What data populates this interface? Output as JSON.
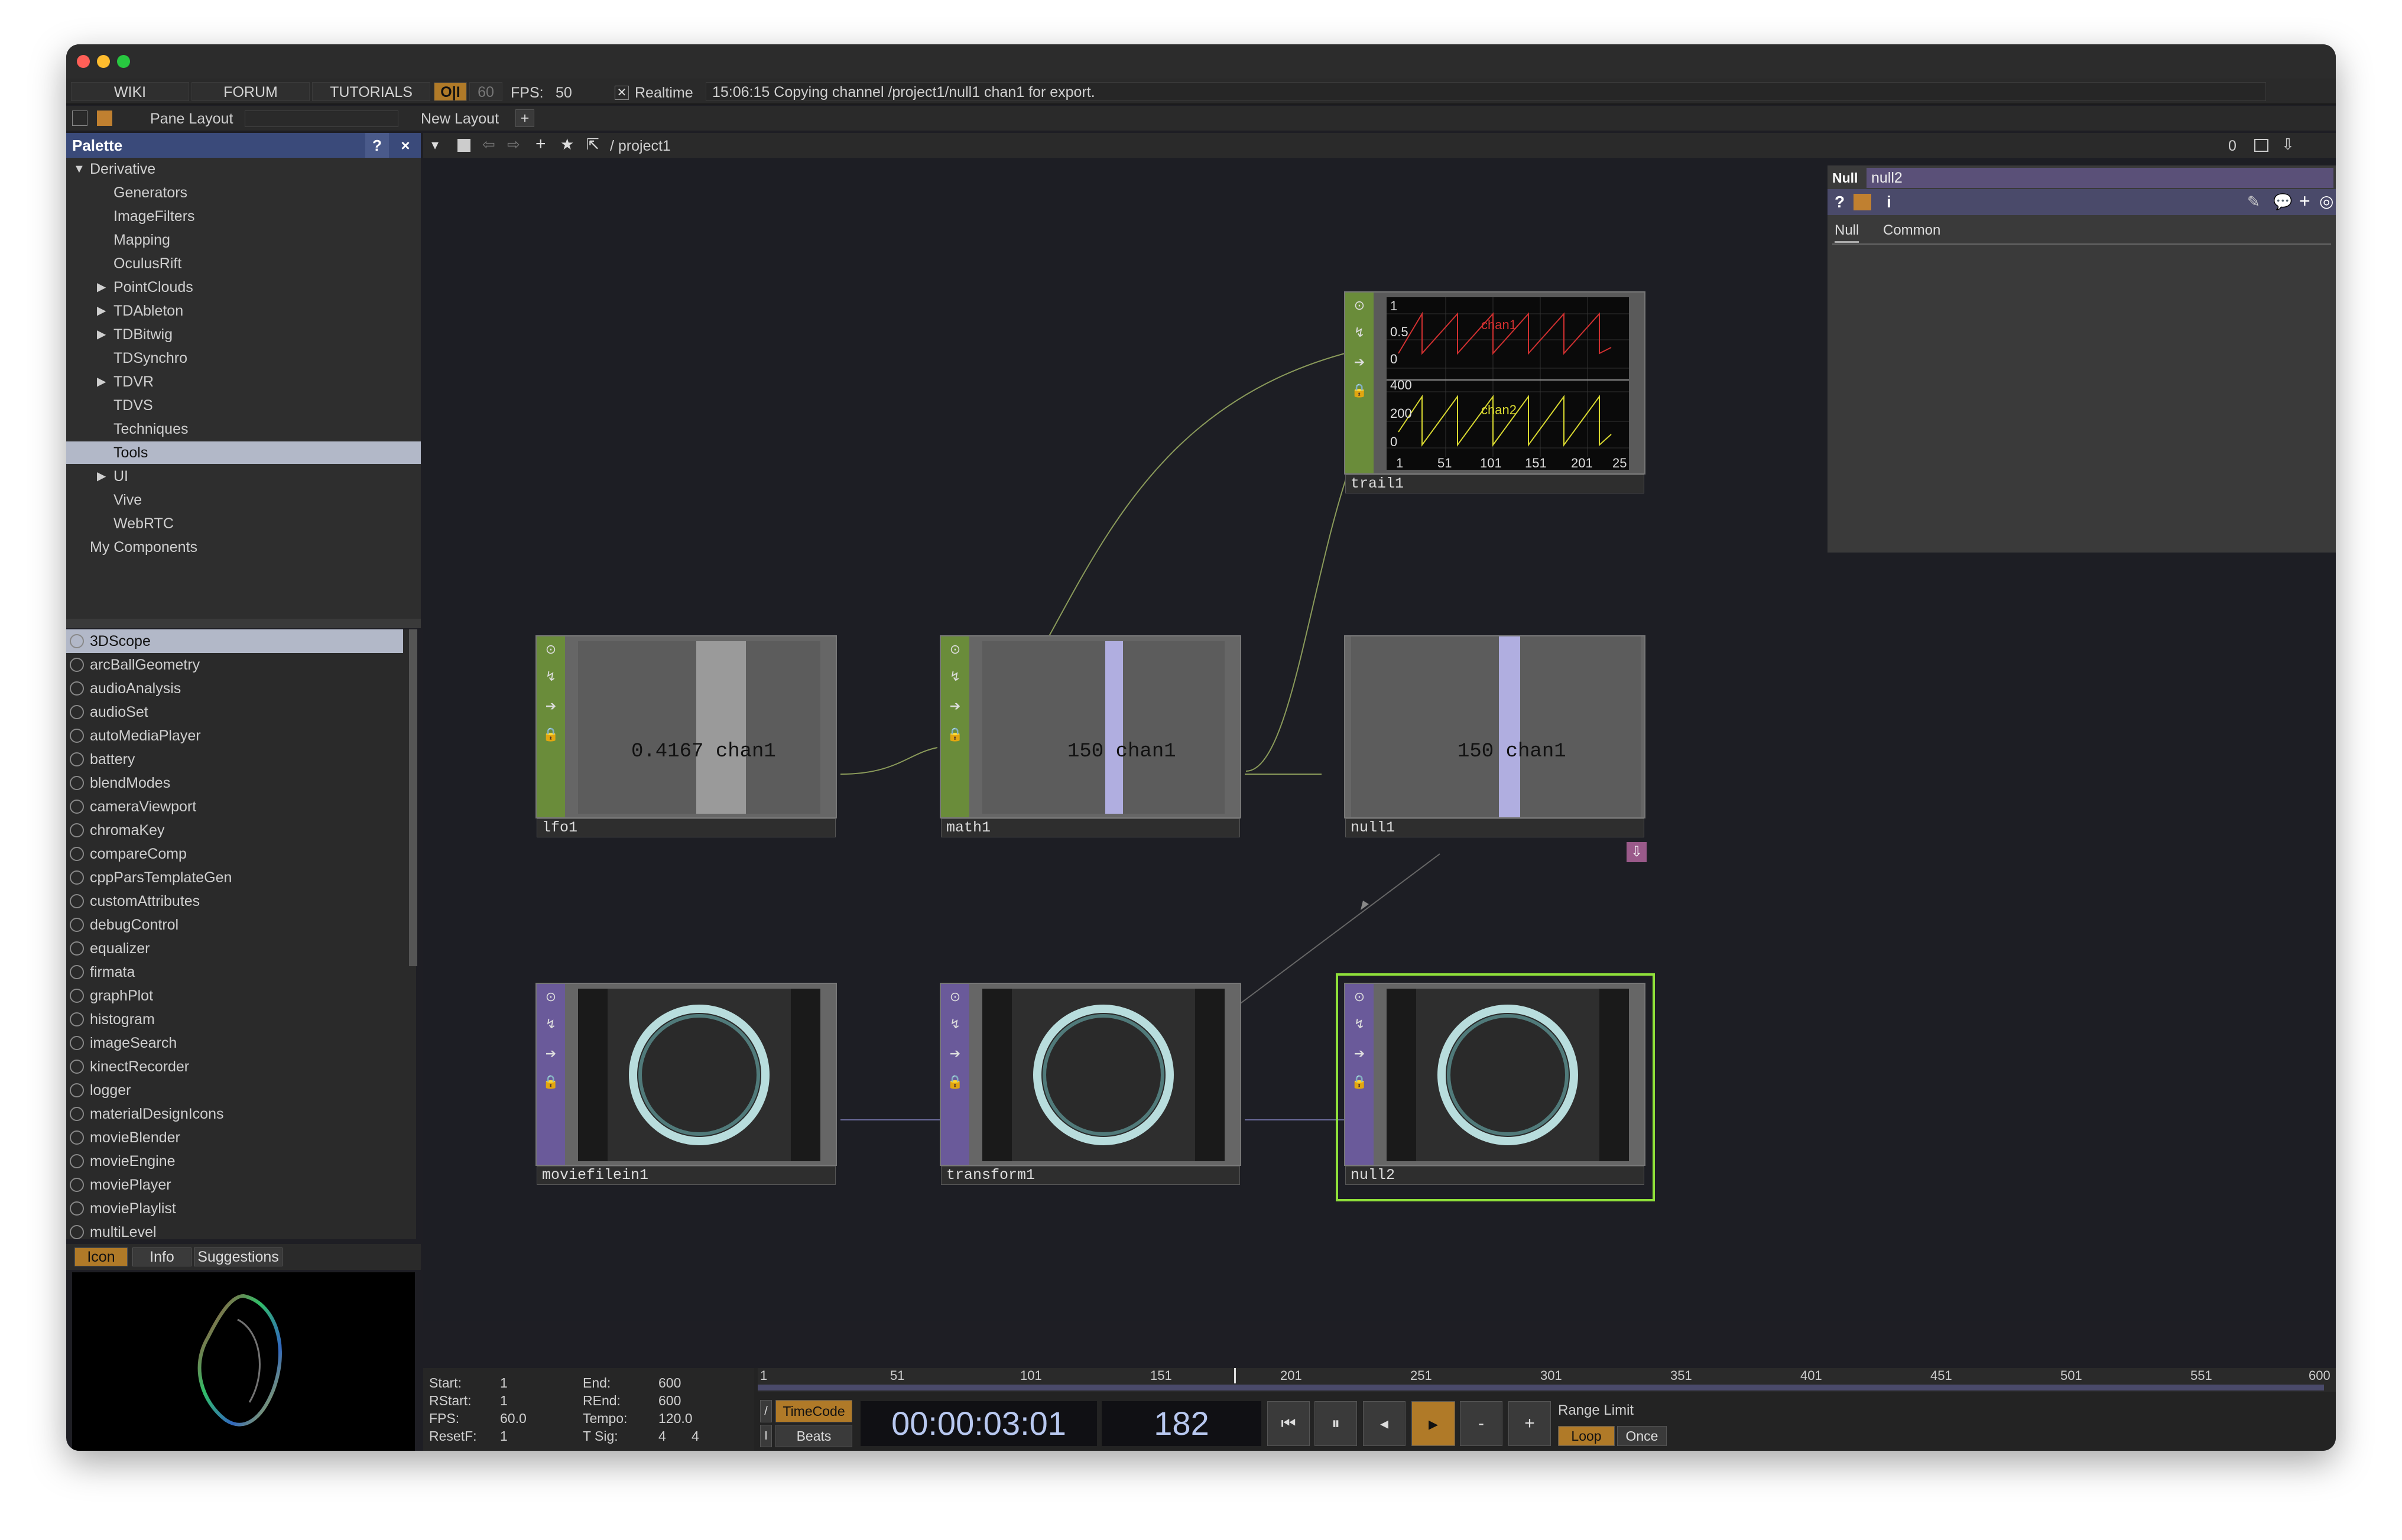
{
  "menubar": {
    "wiki": "WIKI",
    "forum": "FORUM",
    "tutorials": "TUTORIALS",
    "perf": "O|I",
    "fps_cap": "60",
    "fps_label": "FPS:",
    "fps_value": "50",
    "realtime": "Realtime",
    "status": "15:06:15 Copying channel /project1/null1 chan1 for export."
  },
  "toolbar2": {
    "pane_layout": "Pane Layout",
    "new_layout": "New Layout",
    "plus": "+"
  },
  "palette": {
    "title": "Palette",
    "help": "?",
    "close": "×",
    "tree": [
      {
        "label": "Derivative",
        "level": 0,
        "arrow": "down"
      },
      {
        "label": "Generators",
        "level": 1
      },
      {
        "label": "ImageFilters",
        "level": 1
      },
      {
        "label": "Mapping",
        "level": 1
      },
      {
        "label": "OculusRift",
        "level": 1
      },
      {
        "label": "PointClouds",
        "level": 1,
        "arrow": "right"
      },
      {
        "label": "TDAbleton",
        "level": 1,
        "arrow": "right"
      },
      {
        "label": "TDBitwig",
        "level": 1,
        "arrow": "right"
      },
      {
        "label": "TDSynchro",
        "level": 1
      },
      {
        "label": "TDVR",
        "level": 1,
        "arrow": "right"
      },
      {
        "label": "TDVS",
        "level": 1
      },
      {
        "label": "Techniques",
        "level": 1
      },
      {
        "label": "Tools",
        "level": 1,
        "selected": true
      },
      {
        "label": "UI",
        "level": 1,
        "arrow": "right"
      },
      {
        "label": "Vive",
        "level": 1
      },
      {
        "label": "WebRTC",
        "level": 1
      },
      {
        "label": "My Components",
        "level": 0
      }
    ],
    "components": [
      "3DScope",
      "arcBallGeometry",
      "audioAnalysis",
      "audioSet",
      "autoMediaPlayer",
      "battery",
      "blendModes",
      "cameraViewport",
      "chromaKey",
      "compareComp",
      "cppParsTemplateGen",
      "customAttributes",
      "debugControl",
      "equalizer",
      "firmata",
      "graphPlot",
      "histogram",
      "imageSearch",
      "kinectRecorder",
      "logger",
      "materialDesignIcons",
      "movieBlender",
      "movieEngine",
      "moviePlayer",
      "moviePlaylist",
      "multiLevel"
    ],
    "preview_tabs": [
      "Icon",
      "Info",
      "Suggestions"
    ]
  },
  "network": {
    "path": "/ project1",
    "counter": "0"
  },
  "nodes": {
    "lfo1": {
      "name": "lfo1",
      "value": "0.4167 chan1"
    },
    "math1": {
      "name": "math1",
      "value": "150 chan1"
    },
    "null1": {
      "name": "null1",
      "value": "150 chan1"
    },
    "trail1": {
      "name": "trail1",
      "chan1": "chan1",
      "chan2": "chan2",
      "y1": [
        "1",
        "0.5",
        "0"
      ],
      "y2": [
        "400",
        "200",
        "0"
      ],
      "x": [
        "1",
        "51",
        "101",
        "151",
        "201",
        "25"
      ]
    },
    "moviefilein1": {
      "name": "moviefilein1"
    },
    "transform1": {
      "name": "transform1"
    },
    "null2": {
      "name": "null2"
    }
  },
  "params": {
    "type": "Null",
    "name": "null2",
    "tabs": [
      "Null",
      "Common"
    ],
    "help": "?",
    "info": "i"
  },
  "timeline": {
    "ticks": [
      "1",
      "51",
      "101",
      "151",
      "201",
      "251",
      "301",
      "351",
      "401",
      "451",
      "501",
      "551",
      "600"
    ],
    "start_label": "Start:",
    "start": "1",
    "end_label": "End:",
    "end": "600",
    "rstart_label": "RStart:",
    "rstart": "1",
    "rend_label": "REnd:",
    "rend": "600",
    "fps_label": "FPS:",
    "fps": "60.0",
    "tempo_label": "Tempo:",
    "tempo": "120.0",
    "resetf_label": "ResetF:",
    "resetf": "1",
    "tsig_label": "T Sig:",
    "tsig_a": "4",
    "tsig_b": "4",
    "timecode_btn": "TimeCode",
    "beats_btn": "Beats",
    "timecode": "00:00:03:01",
    "frame": "182",
    "range_limit": "Range Limit",
    "loop": "Loop",
    "once": "Once",
    "minus": "-",
    "plus": "+"
  },
  "colors": {
    "chop_green": "#6a8c3a",
    "top_purple": "#6a5a9a",
    "selected_outline": "#8fe03a",
    "palette_header": "#3a4a7a"
  }
}
